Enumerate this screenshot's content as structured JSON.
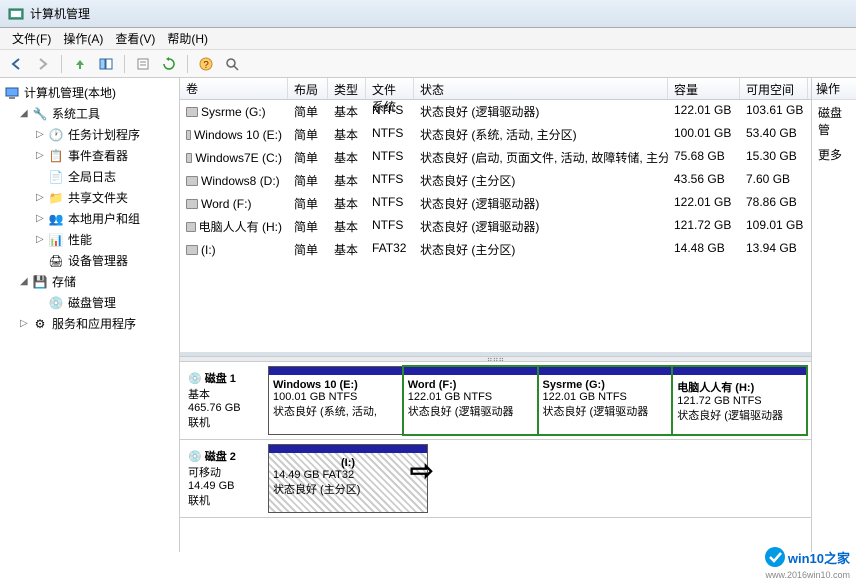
{
  "window_title": "计算机管理",
  "menus": [
    "文件(F)",
    "操作(A)",
    "查看(V)",
    "帮助(H)"
  ],
  "tree_root": "计算机管理(本地)",
  "tree": {
    "sys_tools": "系统工具",
    "task_sched": "任务计划程序",
    "event_viewer": "事件查看器",
    "global_logs": "全局日志",
    "shared_folders": "共享文件夹",
    "local_users": "本地用户和组",
    "performance": "性能",
    "device_mgr": "设备管理器",
    "storage": "存储",
    "disk_mgmt": "磁盘管理",
    "services_apps": "服务和应用程序"
  },
  "vol_headers": {
    "volume": "卷",
    "layout": "布局",
    "type": "类型",
    "fs": "文件系统",
    "status": "状态",
    "capacity": "容量",
    "free": "可用空间"
  },
  "volumes": [
    {
      "name": "Sysrme (G:)",
      "layout": "简单",
      "type": "基本",
      "fs": "NTFS",
      "status": "状态良好 (逻辑驱动器)",
      "cap": "122.01 GB",
      "free": "103.61 GB"
    },
    {
      "name": "Windows 10 (E:)",
      "layout": "简单",
      "type": "基本",
      "fs": "NTFS",
      "status": "状态良好 (系统, 活动, 主分区)",
      "cap": "100.01 GB",
      "free": "53.40 GB"
    },
    {
      "name": "Windows7E (C:)",
      "layout": "简单",
      "type": "基本",
      "fs": "NTFS",
      "status": "状态良好 (启动, 页面文件, 活动, 故障转储, 主分区)",
      "cap": "75.68 GB",
      "free": "15.30 GB"
    },
    {
      "name": "Windows8 (D:)",
      "layout": "简单",
      "type": "基本",
      "fs": "NTFS",
      "status": "状态良好 (主分区)",
      "cap": "43.56 GB",
      "free": "7.60 GB"
    },
    {
      "name": "Word (F:)",
      "layout": "简单",
      "type": "基本",
      "fs": "NTFS",
      "status": "状态良好 (逻辑驱动器)",
      "cap": "122.01 GB",
      "free": "78.86 GB"
    },
    {
      "name": "电脑人人有 (H:)",
      "layout": "简单",
      "type": "基本",
      "fs": "NTFS",
      "status": "状态良好 (逻辑驱动器)",
      "cap": "121.72 GB",
      "free": "109.01 GB"
    },
    {
      "name": "(I:)",
      "layout": "简单",
      "type": "基本",
      "fs": "FAT32",
      "status": "状态良好 (主分区)",
      "cap": "14.48 GB",
      "free": "13.94 GB"
    }
  ],
  "disk1": {
    "label": "磁盘 1",
    "type": "基本",
    "size": "465.76 GB",
    "status": "联机",
    "parts": [
      {
        "name": "Windows 10  (E:)",
        "info": "100.01 GB NTFS",
        "status": "状态良好 (系统, 活动,",
        "green": false
      },
      {
        "name": "Word  (F:)",
        "info": "122.01 GB NTFS",
        "status": "状态良好 (逻辑驱动器",
        "green": true
      },
      {
        "name": "Sysrme  (G:)",
        "info": "122.01 GB NTFS",
        "status": "状态良好 (逻辑驱动器",
        "green": true
      },
      {
        "name": "电脑人人有  (H:)",
        "info": "121.72 GB NTFS",
        "status": "状态良好 (逻辑驱动器",
        "green": true
      }
    ]
  },
  "disk2": {
    "label": "磁盘 2",
    "type": "可移动",
    "size": "14.49 GB",
    "status": "联机",
    "parts": [
      {
        "name": "(I:)",
        "info": "14.49 GB FAT32",
        "status": "状态良好 (主分区)",
        "green": false
      }
    ]
  },
  "actions_header": "操作",
  "actions": [
    "磁盘管",
    "更多"
  ],
  "watermark": {
    "brand": "win10之家",
    "url": "www.2016win10.com"
  }
}
